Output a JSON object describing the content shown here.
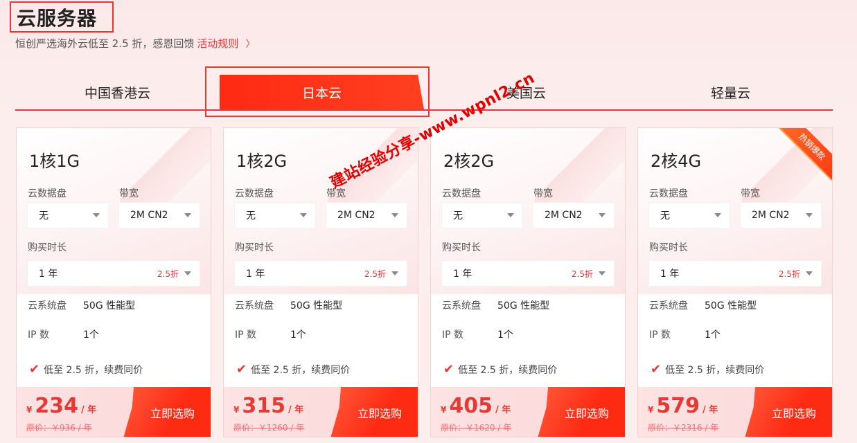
{
  "header": {
    "title": "云服务器",
    "subtitle": "恒创严选海外云低至 2.5 折，感恩回馈",
    "rules_link": "活动规则",
    "chevron": "〉"
  },
  "tabs": [
    {
      "label": "中国香港云",
      "active": false
    },
    {
      "label": "日本云",
      "active": true
    },
    {
      "label": "美国云",
      "active": false
    },
    {
      "label": "轻量云",
      "active": false
    }
  ],
  "labels": {
    "disk": "云数据盘",
    "bandwidth": "带宽",
    "duration": "购买时长",
    "system_disk": "云系统盘",
    "ip_count": "IP 数",
    "promo": "低至 2.5 折，续费同价",
    "buy": "立即选购",
    "yen": "¥",
    "per_year": "/ 年"
  },
  "cards": [
    {
      "title": "1核1G",
      "disk": "无",
      "bandwidth": "2M CN2",
      "duration": "1 年",
      "discount": "2.5折",
      "system_disk": "50G 性能型",
      "ip": "1个",
      "price": "234",
      "original": "原价：￥936 / 年",
      "hot": false
    },
    {
      "title": "1核2G",
      "disk": "无",
      "bandwidth": "2M CN2",
      "duration": "1 年",
      "discount": "2.5折",
      "system_disk": "50G 性能型",
      "ip": "1个",
      "price": "315",
      "original": "原价：￥1260 / 年",
      "hot": false
    },
    {
      "title": "2核2G",
      "disk": "无",
      "bandwidth": "2M CN2",
      "duration": "1 年",
      "discount": "2.5折",
      "system_disk": "50G 性能型",
      "ip": "1个",
      "price": "405",
      "original": "原价：￥1620 / 年",
      "hot": false
    },
    {
      "title": "2核4G",
      "disk": "无",
      "bandwidth": "2M CN2",
      "duration": "1 年",
      "discount": "2.5折",
      "system_disk": "50G 性能型",
      "ip": "1个",
      "price": "579",
      "original": "原价：￥2316 / 年",
      "hot": true,
      "hot_label": "热销爆款"
    }
  ],
  "watermark": "建站经验分享-www.wpnl2.cn",
  "colors": {
    "accent": "#e53935",
    "tab_active": "#ff2a12"
  }
}
